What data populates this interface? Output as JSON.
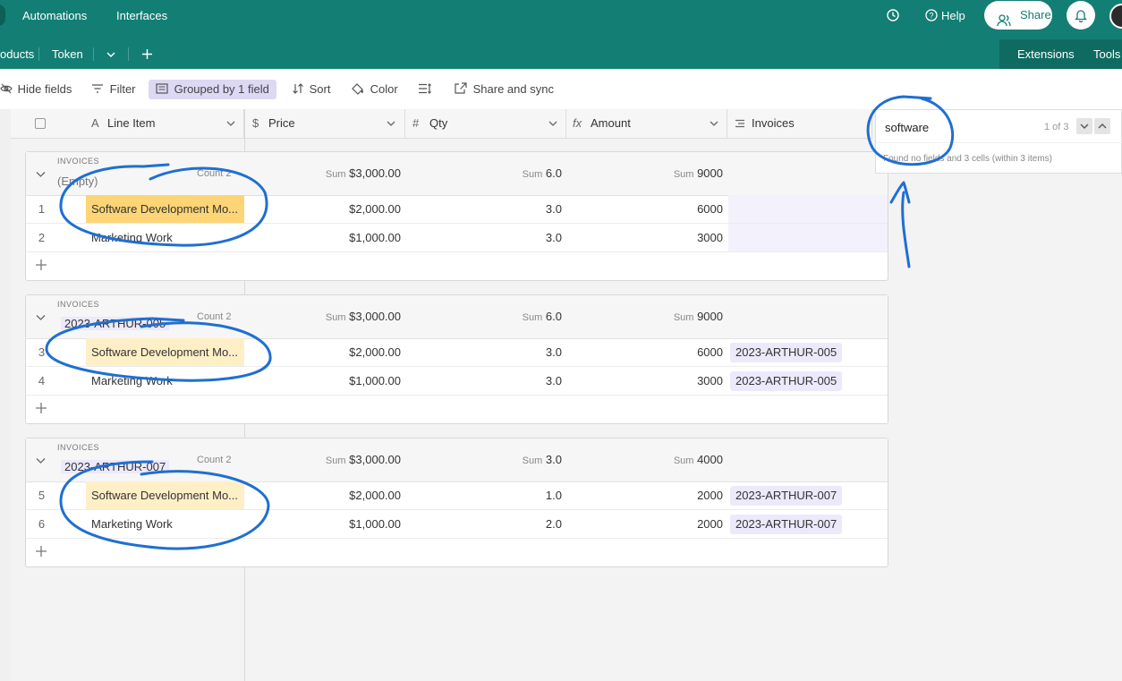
{
  "topbar": {
    "nav": [
      "Automations",
      "Interfaces"
    ],
    "help_label": "Help",
    "share_label": "Share"
  },
  "tabbar": {
    "tabs": [
      "oducts",
      "Token"
    ],
    "extensions_label": "Extensions",
    "tools_label": "Tools"
  },
  "toolbar": {
    "hide_fields": "Hide fields",
    "filter": "Filter",
    "grouped": "Grouped by 1 field",
    "sort": "Sort",
    "color": "Color",
    "share_sync": "Share and sync"
  },
  "columns": {
    "line_item": "Line Item",
    "price": "Price",
    "qty": "Qty",
    "amount": "Amount",
    "invoices": "Invoices"
  },
  "search": {
    "query": "software",
    "position": "1 of 3",
    "result_text": "Found no fields and 3 cells (within 3 items)"
  },
  "groups": [
    {
      "field_label": "INVOICES",
      "name": "(Empty)",
      "count": "Count 2",
      "sum_price": "$3,000.00",
      "sum_qty": "6.0",
      "sum_amount": "9000",
      "rows": [
        {
          "num": "1",
          "item": "Software Development Mo...",
          "price": "$2,000.00",
          "qty": "3.0",
          "amount": "6000",
          "invoice": ""
        },
        {
          "num": "2",
          "item": "Marketing Work",
          "price": "$1,000.00",
          "qty": "3.0",
          "amount": "3000",
          "invoice": ""
        }
      ]
    },
    {
      "field_label": "INVOICES",
      "name": "2023-ARTHUR-005",
      "count": "Count 2",
      "sum_price": "$3,000.00",
      "sum_qty": "6.0",
      "sum_amount": "9000",
      "rows": [
        {
          "num": "3",
          "item": "Software Development Mo...",
          "price": "$2,000.00",
          "qty": "3.0",
          "amount": "6000",
          "invoice": "2023-ARTHUR-005"
        },
        {
          "num": "4",
          "item": "Marketing Work",
          "price": "$1,000.00",
          "qty": "3.0",
          "amount": "3000",
          "invoice": "2023-ARTHUR-005"
        }
      ]
    },
    {
      "field_label": "INVOICES",
      "name": "2023-ARTHUR-007",
      "count": "Count 2",
      "sum_price": "$3,000.00",
      "sum_qty": "3.0",
      "sum_amount": "4000",
      "rows": [
        {
          "num": "5",
          "item": "Software Development Mo...",
          "price": "$2,000.00",
          "qty": "1.0",
          "amount": "2000",
          "invoice": "2023-ARTHUR-007"
        },
        {
          "num": "6",
          "item": "Marketing Work",
          "price": "$1,000.00",
          "qty": "2.0",
          "amount": "2000",
          "invoice": "2023-ARTHUR-007"
        }
      ]
    }
  ],
  "sum_label": "Sum",
  "colors": {
    "header": "#137e74",
    "highlight": "#ffefc7",
    "highlight_active": "#fdd576",
    "annotation": "#1f6fd1"
  }
}
